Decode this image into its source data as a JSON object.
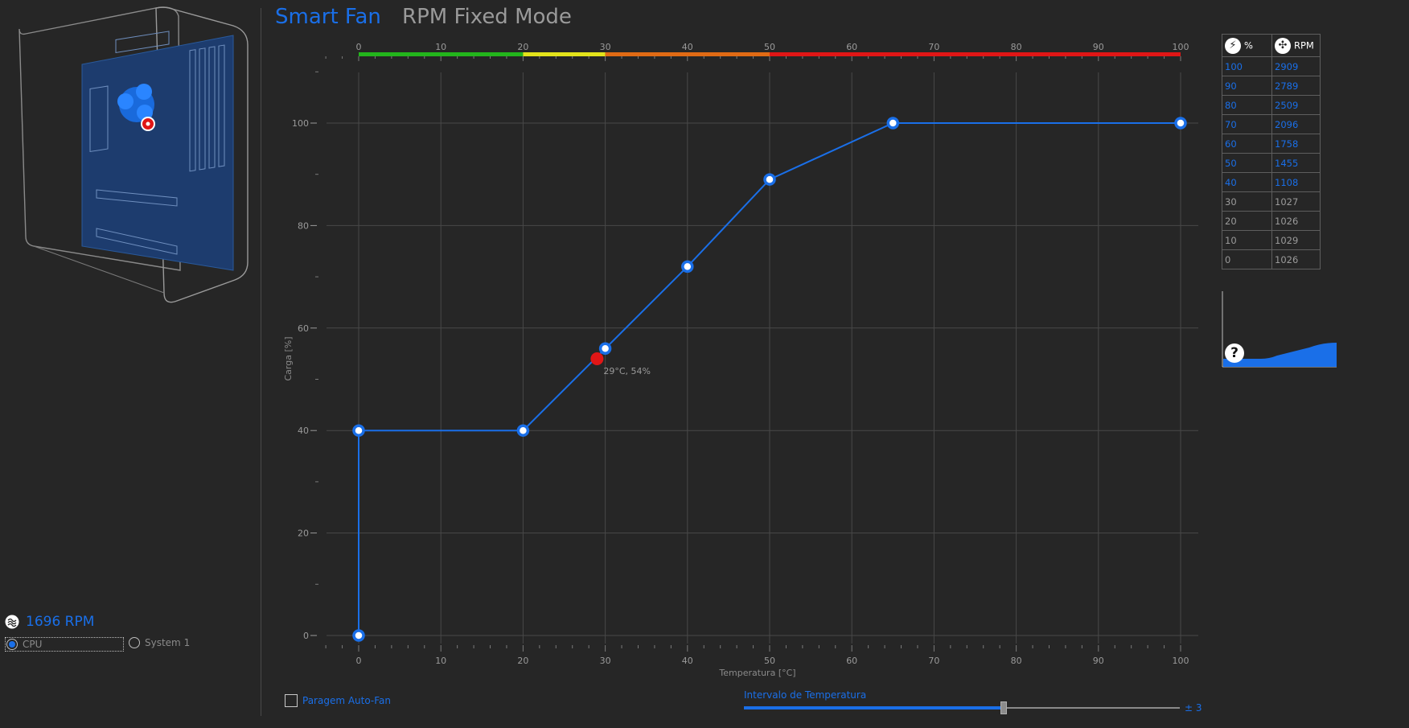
{
  "tabs": {
    "smart_fan": "Smart Fan",
    "rpm_fixed": "RPM Fixed Mode"
  },
  "fan_status": {
    "rpm": "1696 RPM",
    "icon": "fan-icon"
  },
  "fan_select": {
    "options": [
      {
        "label": "CPU",
        "selected": true
      },
      {
        "label": "System 1",
        "selected": false
      }
    ]
  },
  "chart_data": {
    "type": "line",
    "xlabel": "Temperatura [°C]",
    "ylabel": "Carga [%]",
    "xlim": [
      0,
      100
    ],
    "ylim": [
      0,
      100
    ],
    "x_ticks": [
      "0",
      "10",
      "20",
      "30",
      "40",
      "50",
      "60",
      "70",
      "80",
      "90",
      "100"
    ],
    "y_ticks": [
      "0",
      "20",
      "40",
      "60",
      "80",
      "100"
    ],
    "top_scale_ticks": [
      "0",
      "10",
      "20",
      "30",
      "40",
      "50",
      "60",
      "70",
      "80",
      "90",
      "100"
    ],
    "top_scale_segments": [
      {
        "from": 0,
        "to": 20,
        "color": "#23b51c"
      },
      {
        "from": 20,
        "to": 30,
        "color": "#e3e31b"
      },
      {
        "from": 30,
        "to": 50,
        "color": "#e06a14"
      },
      {
        "from": 50,
        "to": 100,
        "color": "#e01616"
      }
    ],
    "series": [
      {
        "points": [
          [
            0,
            0
          ],
          [
            0,
            40
          ],
          [
            20,
            40
          ],
          [
            30,
            56
          ],
          [
            40,
            72
          ],
          [
            50,
            89
          ],
          [
            65,
            100
          ],
          [
            100,
            100
          ]
        ]
      }
    ],
    "current_point": {
      "x": 29,
      "y": 54,
      "label": "29°C, 54%"
    },
    "grid": true,
    "line_color": "#1a6fe8"
  },
  "rpm_table": {
    "headers": [
      "%",
      "RPM"
    ],
    "rows": [
      {
        "pct": "100",
        "rpm": "2909",
        "active": true
      },
      {
        "pct": "90",
        "rpm": "2789",
        "active": true
      },
      {
        "pct": "80",
        "rpm": "2509",
        "active": true
      },
      {
        "pct": "70",
        "rpm": "2096",
        "active": true
      },
      {
        "pct": "60",
        "rpm": "1758",
        "active": true
      },
      {
        "pct": "50",
        "rpm": "1455",
        "active": true
      },
      {
        "pct": "40",
        "rpm": "1108",
        "active": true
      },
      {
        "pct": "30",
        "rpm": "1027",
        "active": false
      },
      {
        "pct": "20",
        "rpm": "1026",
        "active": false
      },
      {
        "pct": "10",
        "rpm": "1029",
        "active": false
      },
      {
        "pct": "0",
        "rpm": "1026",
        "active": false
      }
    ]
  },
  "help": {
    "symbol": "?"
  },
  "autofan": {
    "label": "Paragem Auto-Fan",
    "checked": false
  },
  "interval": {
    "label": "Intervalo de Temperatura",
    "value_label": "± 3",
    "fraction": 0.6
  },
  "colors": {
    "accent": "#1a6fe8",
    "background": "#262626",
    "alert": "#e01616"
  }
}
